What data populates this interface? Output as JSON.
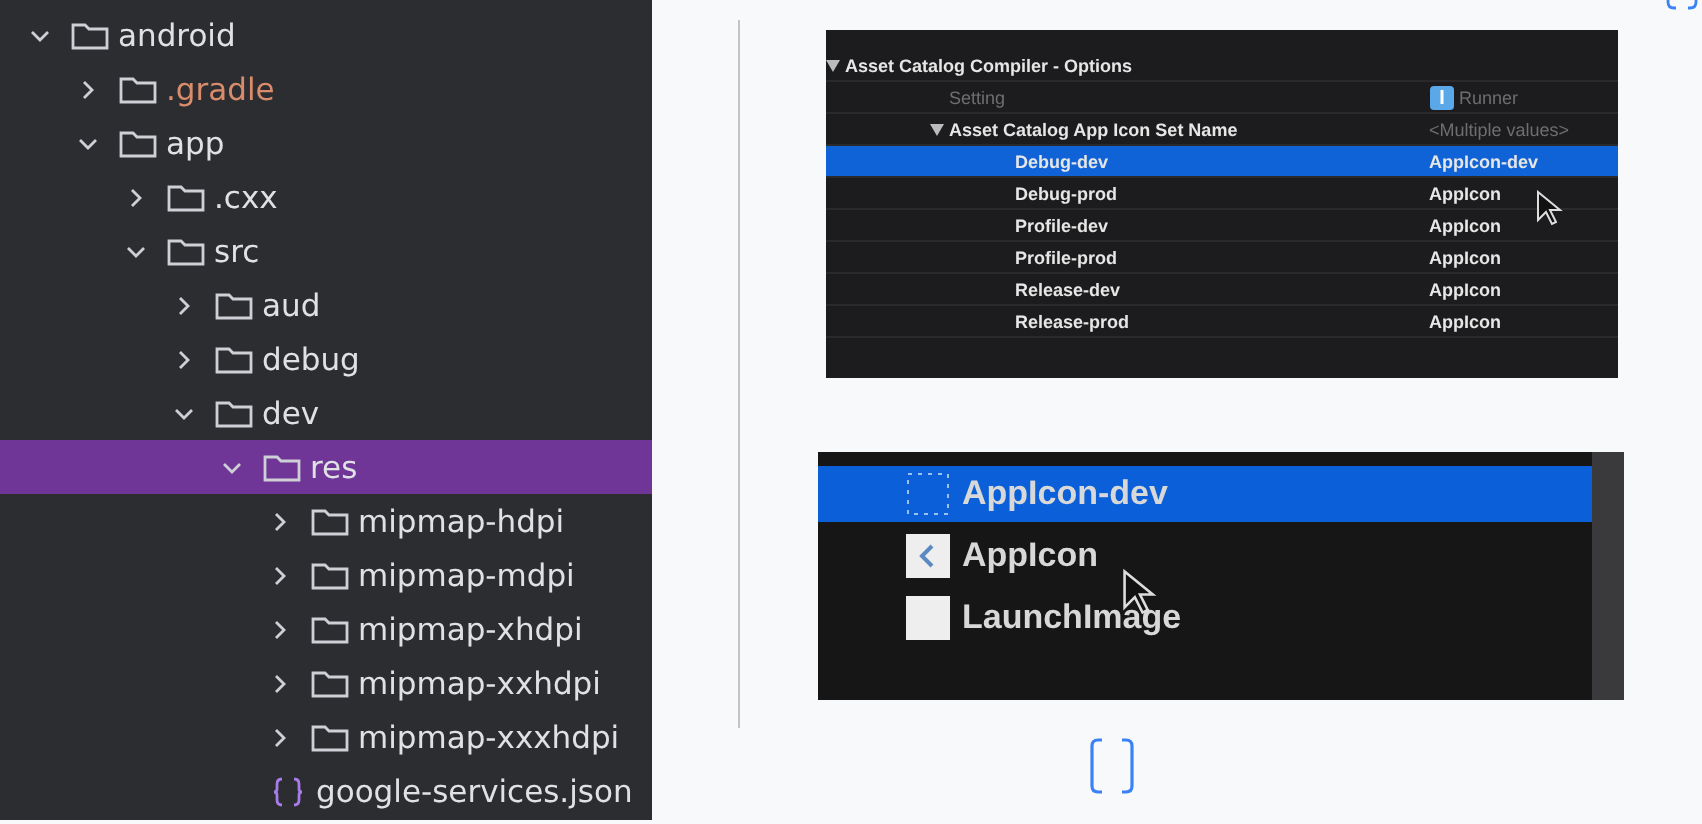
{
  "project_tree": [
    {
      "label": "android",
      "kind": "folder",
      "expanded": true,
      "selected": false,
      "ignored": false,
      "children": [
        {
          "label": ".gradle",
          "kind": "folder",
          "expanded": false,
          "selected": false,
          "ignored": true
        },
        {
          "label": "app",
          "kind": "folder",
          "expanded": true,
          "selected": false,
          "ignored": false,
          "children": [
            {
              "label": ".cxx",
              "kind": "folder",
              "expanded": false,
              "selected": false,
              "ignored": false
            },
            {
              "label": "src",
              "kind": "folder",
              "expanded": true,
              "selected": false,
              "ignored": false,
              "children": [
                {
                  "label": "aud",
                  "kind": "folder",
                  "expanded": false,
                  "selected": false,
                  "ignored": false
                },
                {
                  "label": "debug",
                  "kind": "folder",
                  "expanded": false,
                  "selected": false,
                  "ignored": false
                },
                {
                  "label": "dev",
                  "kind": "folder",
                  "expanded": true,
                  "selected": false,
                  "ignored": false,
                  "children": [
                    {
                      "label": "res",
                      "kind": "folder",
                      "expanded": true,
                      "selected": true,
                      "ignored": false,
                      "children": [
                        {
                          "label": "mipmap-hdpi",
                          "kind": "folder",
                          "expanded": false,
                          "selected": false,
                          "ignored": false
                        },
                        {
                          "label": "mipmap-mdpi",
                          "kind": "folder",
                          "expanded": false,
                          "selected": false,
                          "ignored": false
                        },
                        {
                          "label": "mipmap-xhdpi",
                          "kind": "folder",
                          "expanded": false,
                          "selected": false,
                          "ignored": false
                        },
                        {
                          "label": "mipmap-xxhdpi",
                          "kind": "folder",
                          "expanded": false,
                          "selected": false,
                          "ignored": false
                        },
                        {
                          "label": "mipmap-xxxhdpi",
                          "kind": "folder",
                          "expanded": false,
                          "selected": false,
                          "ignored": false
                        },
                        {
                          "label": "google-services.json",
                          "kind": "json",
                          "selected": false,
                          "ignored": false
                        }
                      ]
                    }
                  ]
                }
              ]
            }
          ]
        }
      ]
    }
  ],
  "build_settings": {
    "section": "Asset Catalog Compiler - Options",
    "column_setting": "Setting",
    "column_target": "Runner",
    "setting": {
      "name": "Asset Catalog App Icon Set Name",
      "value": "<Multiple values>"
    },
    "rows": [
      {
        "name": "Debug-dev",
        "value": "AppIcon-dev",
        "selected": true
      },
      {
        "name": "Debug-prod",
        "value": "AppIcon",
        "selected": false
      },
      {
        "name": "Profile-dev",
        "value": "AppIcon",
        "selected": false
      },
      {
        "name": "Profile-prod",
        "value": "AppIcon",
        "selected": false
      },
      {
        "name": "Release-dev",
        "value": "AppIcon",
        "selected": false
      },
      {
        "name": "Release-prod",
        "value": "AppIcon",
        "selected": false
      }
    ]
  },
  "asset_list": [
    {
      "label": "AppIcon-dev",
      "kind": "dotted",
      "selected": true
    },
    {
      "label": "AppIcon",
      "kind": "image",
      "selected": false
    },
    {
      "label": "LaunchImage",
      "kind": "blank",
      "selected": false
    }
  ]
}
